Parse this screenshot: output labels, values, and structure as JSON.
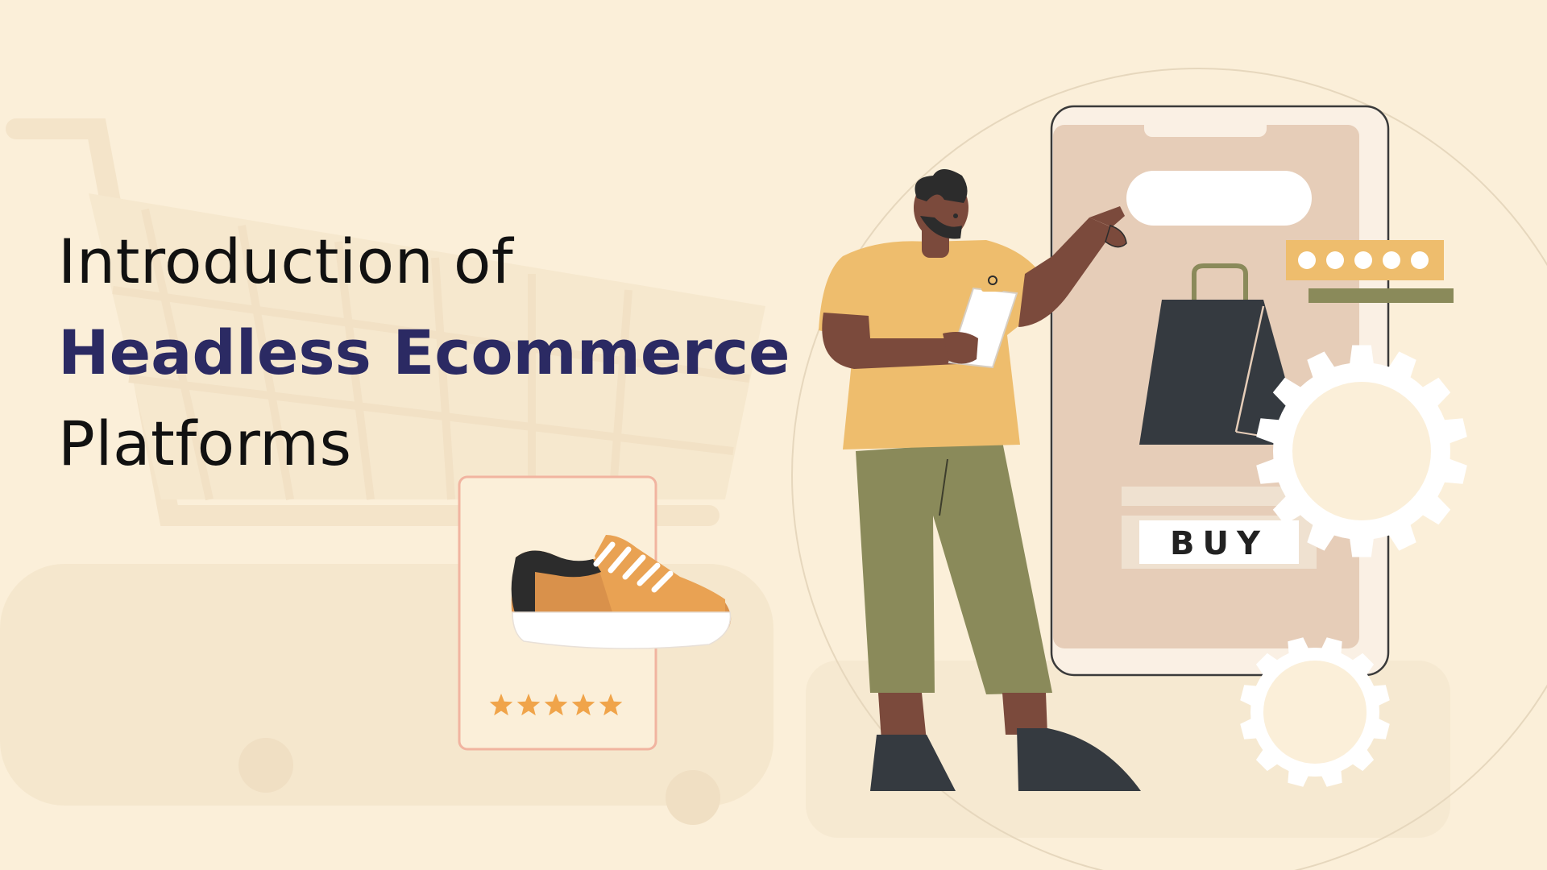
{
  "heading": {
    "line1": "Introduction of",
    "line2": "Headless Ecommerce",
    "line3": "Platforms"
  },
  "phone": {
    "buy_label": "BUY",
    "rating_dots": 5
  },
  "product_card": {
    "stars": 5,
    "star_glyph": "★"
  },
  "colors": {
    "background": "#fbefd9",
    "title_accent": "#2b2a63",
    "shirt": "#eebd6d",
    "pants": "#8a8a5a",
    "skin": "#7b4a3c",
    "bag": "#353a40",
    "phone_screen": "#e6cdb8",
    "star": "#f0a44a",
    "card_border": "#f1b4a0",
    "rating_bar": "#eebd6d",
    "rating_line": "#8a8a5a"
  },
  "icons": [
    "shopping-cart-icon",
    "shopping-bag-icon",
    "sneaker-icon",
    "gear-icon",
    "star-icon",
    "clipboard-icon"
  ]
}
